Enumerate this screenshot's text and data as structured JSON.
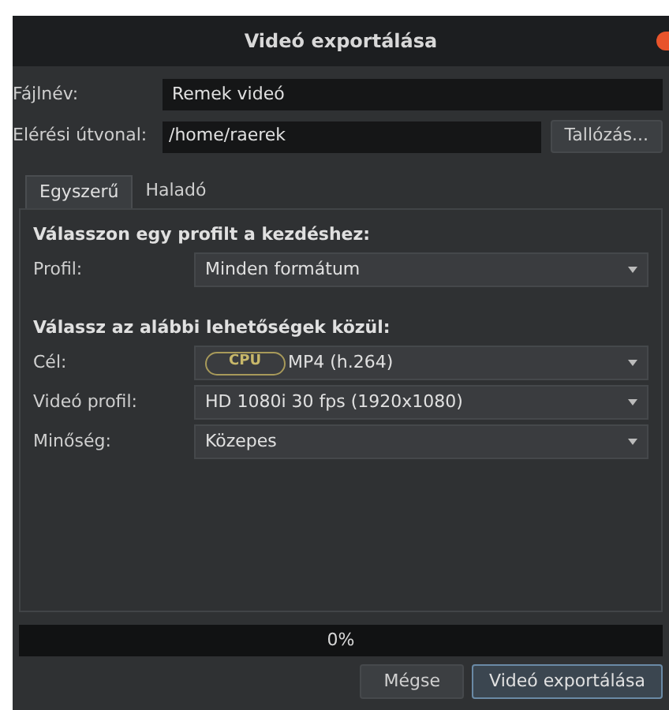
{
  "window": {
    "title": "Videó exportálása"
  },
  "file_name": {
    "label": "Fájlnév:",
    "value": "Remek videó"
  },
  "path": {
    "label": "Elérési útvonal:",
    "value": "/home/raerek",
    "browse_button": "Tallózás..."
  },
  "tabs": [
    {
      "label": "Egyszerű",
      "selected": true
    },
    {
      "label": "Haladó",
      "selected": false
    }
  ],
  "sections": [
    {
      "heading": "Válasszon egy profilt a kezdéshez:",
      "rows": [
        {
          "label": "Profil:",
          "value": "Minden formátum"
        }
      ]
    },
    {
      "heading": "Válassz az alábbi lehetőségek közül:",
      "rows": [
        {
          "label": "Cél:",
          "badge": "CPU",
          "value": "MP4 (h.264)"
        },
        {
          "label": "Videó profil:",
          "value": "HD 1080i 30 fps (1920x1080)"
        },
        {
          "label": "Minőség:",
          "value": "Közepes"
        }
      ]
    }
  ],
  "progress": {
    "level": 0,
    "reading": "0%"
  },
  "buttons": [
    {
      "label": "Mégse",
      "kind": "normal"
    },
    {
      "label": "Videó exportálása",
      "kind": "default"
    }
  ]
}
